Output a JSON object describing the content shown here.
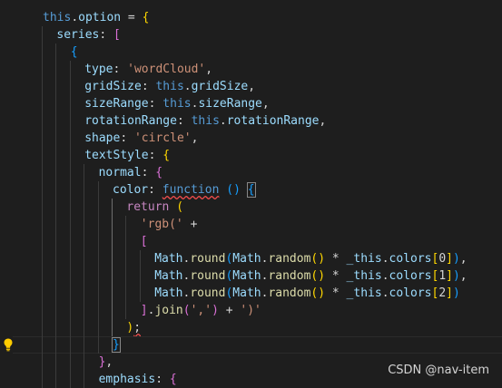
{
  "editor": {
    "lines": [
      {
        "indent": 1,
        "tokens": [
          {
            "t": "this",
            "c": "k"
          },
          {
            "t": ".",
            "c": "w"
          },
          {
            "t": "option",
            "c": "p"
          },
          {
            "t": " = ",
            "c": "w"
          },
          {
            "t": "{",
            "c": "b1"
          }
        ]
      },
      {
        "indent": 2,
        "tokens": [
          {
            "t": "series",
            "c": "p"
          },
          {
            "t": ": ",
            "c": "w"
          },
          {
            "t": "[",
            "c": "b2"
          }
        ]
      },
      {
        "indent": 3,
        "tokens": [
          {
            "t": "{",
            "c": "b3"
          }
        ]
      },
      {
        "indent": 4,
        "tokens": [
          {
            "t": "type",
            "c": "p"
          },
          {
            "t": ": ",
            "c": "w"
          },
          {
            "t": "'wordCloud'",
            "c": "s"
          },
          {
            "t": ",",
            "c": "w"
          }
        ]
      },
      {
        "indent": 4,
        "tokens": [
          {
            "t": "gridSize",
            "c": "p"
          },
          {
            "t": ": ",
            "c": "w"
          },
          {
            "t": "this",
            "c": "k"
          },
          {
            "t": ".",
            "c": "w"
          },
          {
            "t": "gridSize",
            "c": "p"
          },
          {
            "t": ",",
            "c": "w"
          }
        ]
      },
      {
        "indent": 4,
        "tokens": [
          {
            "t": "sizeRange",
            "c": "p"
          },
          {
            "t": ": ",
            "c": "w"
          },
          {
            "t": "this",
            "c": "k"
          },
          {
            "t": ".",
            "c": "w"
          },
          {
            "t": "sizeRange",
            "c": "p"
          },
          {
            "t": ",",
            "c": "w"
          }
        ]
      },
      {
        "indent": 4,
        "tokens": [
          {
            "t": "rotationRange",
            "c": "p"
          },
          {
            "t": ": ",
            "c": "w"
          },
          {
            "t": "this",
            "c": "k"
          },
          {
            "t": ".",
            "c": "w"
          },
          {
            "t": "rotationRange",
            "c": "p"
          },
          {
            "t": ",",
            "c": "w"
          }
        ]
      },
      {
        "indent": 4,
        "tokens": [
          {
            "t": "shape",
            "c": "p"
          },
          {
            "t": ": ",
            "c": "w"
          },
          {
            "t": "'circle'",
            "c": "s"
          },
          {
            "t": ",",
            "c": "w"
          }
        ]
      },
      {
        "indent": 4,
        "tokens": [
          {
            "t": "textStyle",
            "c": "p"
          },
          {
            "t": ": ",
            "c": "w"
          },
          {
            "t": "{",
            "c": "b1"
          }
        ]
      },
      {
        "indent": 5,
        "tokens": [
          {
            "t": "normal",
            "c": "p"
          },
          {
            "t": ": ",
            "c": "w"
          },
          {
            "t": "{",
            "c": "b2"
          }
        ]
      },
      {
        "indent": 6,
        "tokens": [
          {
            "t": "color",
            "c": "p"
          },
          {
            "t": ": ",
            "c": "w"
          },
          {
            "t": "function",
            "c": "k sq"
          },
          {
            "t": " ",
            "c": "w"
          },
          {
            "t": "()",
            "c": "b3"
          },
          {
            "t": " ",
            "c": "w"
          },
          {
            "t": "{",
            "c": "b3 boxed"
          }
        ]
      },
      {
        "indent": 7,
        "tokens": [
          {
            "t": "return",
            "c": "r"
          },
          {
            "t": " ",
            "c": "w"
          },
          {
            "t": "(",
            "c": "b1"
          }
        ]
      },
      {
        "indent": 8,
        "tokens": [
          {
            "t": "'rgb('",
            "c": "s"
          },
          {
            "t": " +",
            "c": "w"
          }
        ]
      },
      {
        "indent": 8,
        "tokens": [
          {
            "t": "[",
            "c": "b2"
          }
        ]
      },
      {
        "indent": 9,
        "tokens": [
          {
            "t": "Math",
            "c": "p"
          },
          {
            "t": ".",
            "c": "w"
          },
          {
            "t": "round",
            "c": "f"
          },
          {
            "t": "(",
            "c": "b3"
          },
          {
            "t": "Math",
            "c": "p"
          },
          {
            "t": ".",
            "c": "w"
          },
          {
            "t": "random",
            "c": "f"
          },
          {
            "t": "()",
            "c": "b1"
          },
          {
            "t": " * ",
            "c": "w"
          },
          {
            "t": "_this",
            "c": "p"
          },
          {
            "t": ".",
            "c": "w"
          },
          {
            "t": "colors",
            "c": "p"
          },
          {
            "t": "[",
            "c": "b1"
          },
          {
            "t": "0",
            "c": "w"
          },
          {
            "t": "]",
            "c": "b1"
          },
          {
            "t": ")",
            "c": "b3"
          },
          {
            "t": ",",
            "c": "w"
          }
        ]
      },
      {
        "indent": 9,
        "tokens": [
          {
            "t": "Math",
            "c": "p"
          },
          {
            "t": ".",
            "c": "w"
          },
          {
            "t": "round",
            "c": "f"
          },
          {
            "t": "(",
            "c": "b3"
          },
          {
            "t": "Math",
            "c": "p"
          },
          {
            "t": ".",
            "c": "w"
          },
          {
            "t": "random",
            "c": "f"
          },
          {
            "t": "()",
            "c": "b1"
          },
          {
            "t": " * ",
            "c": "w"
          },
          {
            "t": "_this",
            "c": "p"
          },
          {
            "t": ".",
            "c": "w"
          },
          {
            "t": "colors",
            "c": "p"
          },
          {
            "t": "[",
            "c": "b1"
          },
          {
            "t": "1",
            "c": "w"
          },
          {
            "t": "]",
            "c": "b1"
          },
          {
            "t": ")",
            "c": "b3"
          },
          {
            "t": ",",
            "c": "w"
          }
        ]
      },
      {
        "indent": 9,
        "tokens": [
          {
            "t": "Math",
            "c": "p"
          },
          {
            "t": ".",
            "c": "w"
          },
          {
            "t": "round",
            "c": "f"
          },
          {
            "t": "(",
            "c": "b3"
          },
          {
            "t": "Math",
            "c": "p"
          },
          {
            "t": ".",
            "c": "w"
          },
          {
            "t": "random",
            "c": "f"
          },
          {
            "t": "()",
            "c": "b1"
          },
          {
            "t": " * ",
            "c": "w"
          },
          {
            "t": "_this",
            "c": "p"
          },
          {
            "t": ".",
            "c": "w"
          },
          {
            "t": "colors",
            "c": "p"
          },
          {
            "t": "[",
            "c": "b1"
          },
          {
            "t": "2",
            "c": "w"
          },
          {
            "t": "]",
            "c": "b1"
          },
          {
            "t": ")",
            "c": "b3"
          }
        ]
      },
      {
        "indent": 8,
        "tokens": [
          {
            "t": "]",
            "c": "b2"
          },
          {
            "t": ".",
            "c": "w"
          },
          {
            "t": "join",
            "c": "f"
          },
          {
            "t": "(",
            "c": "b2"
          },
          {
            "t": "','",
            "c": "s"
          },
          {
            "t": ")",
            "c": "b2"
          },
          {
            "t": " + ",
            "c": "w"
          },
          {
            "t": "')'",
            "c": "s"
          }
        ]
      },
      {
        "indent": 7,
        "tokens": [
          {
            "t": ")",
            "c": "b1"
          },
          {
            "t": ";",
            "c": "w sq"
          }
        ]
      },
      {
        "indent": 6,
        "tokens": [
          {
            "t": "}",
            "c": "b3 boxed"
          }
        ]
      },
      {
        "indent": 5,
        "tokens": [
          {
            "t": "}",
            "c": "b2"
          },
          {
            "t": ",",
            "c": "w"
          }
        ]
      },
      {
        "indent": 5,
        "tokens": [
          {
            "t": "emphasis",
            "c": "p"
          },
          {
            "t": ": ",
            "c": "w"
          },
          {
            "t": "{",
            "c": "b2"
          }
        ]
      }
    ]
  },
  "watermark": "CSDN @nav-item",
  "colors": {
    "background": "#1e1e1e",
    "keyword": "#569cd6",
    "property": "#9cdcfe",
    "string": "#ce9178",
    "function": "#dcdcaa",
    "control": "#c586c0"
  },
  "icons": {
    "gutter": "lightbulb-icon"
  }
}
